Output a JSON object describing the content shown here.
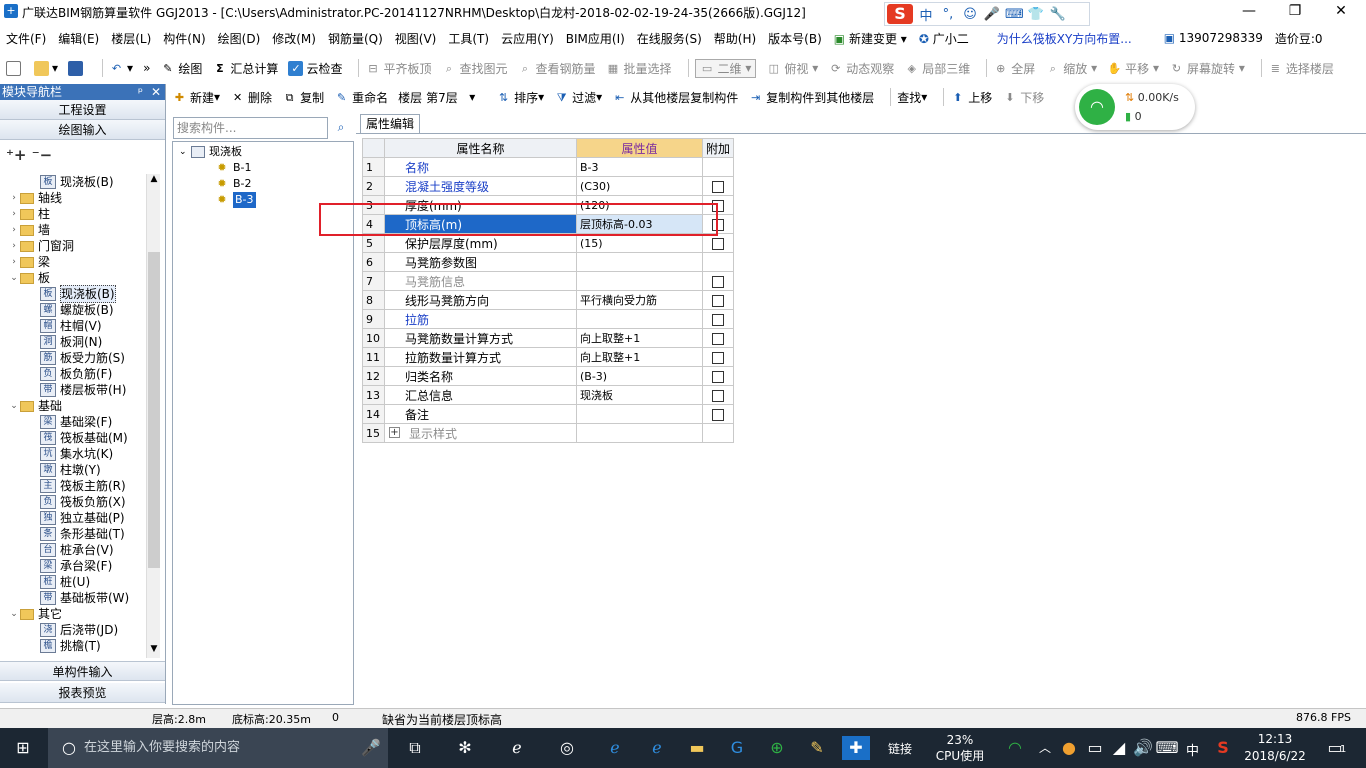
{
  "titlebar": {
    "title": "广联达BIM钢筋算量软件 GGJ2013 - [C:\\Users\\Administrator.PC-20141127NRHM\\Desktop\\白龙村-2018-02-02-19-24-35(2666版).GGJ12]",
    "minimize": "—",
    "restore": "❐",
    "close": "✕",
    "ime": {
      "logo": "S",
      "items": [
        "中",
        "°,",
        "☺",
        "🎤",
        "⌨",
        "👕",
        "🔧"
      ]
    }
  },
  "menubar": {
    "items": [
      "文件(F)",
      "编辑(E)",
      "楼层(L)",
      "构件(N)",
      "绘图(D)",
      "修改(M)",
      "钢筋量(Q)",
      "视图(V)",
      "工具(T)",
      "云应用(Y)",
      "BIM应用(I)",
      "在线服务(S)",
      "帮助(H)",
      "版本号(B)"
    ],
    "new_change": "新建变更",
    "guangxiaoer": "广小二",
    "question": "为什么筏板XY方向布置...",
    "phone": "13907298339",
    "price": "造价豆:0"
  },
  "toolbar1": {
    "draw": "绘图",
    "summary": "汇总计算",
    "cloud_check": "云检查",
    "flat_top": "平齐板顶",
    "find_elem": "查找图元",
    "view_rebar": "查看钢筋量",
    "batch_select": "批量选择",
    "view_mode": "二维",
    "overlook": "俯视",
    "dynamic_view": "动态观察",
    "local_3d": "局部三维",
    "fullscreen": "全屏",
    "zoom": "缩放",
    "pan": "平移",
    "screen_rotate": "屏幕旋转",
    "select_floor": "选择楼层"
  },
  "toolbar2": {
    "new": "新建",
    "delete": "删除",
    "copy": "复制",
    "rename": "重命名",
    "floor_label": "楼层",
    "floor_value": "第7层",
    "sort": "排序",
    "filter": "过滤",
    "copy_from": "从其他楼层复制构件",
    "copy_to": "复制构件到其他楼层",
    "find": "查找",
    "up": "上移",
    "down": "下移"
  },
  "network": {
    "speed": "0.00K/s",
    "count": "0"
  },
  "nav": {
    "header": "模块导航栏",
    "pin": "ᵖ",
    "close": "✕",
    "eng_settings": "工程设置",
    "draw_input": "绘图输入",
    "single_input": "单构件输入",
    "report_preview": "报表预览",
    "tree": [
      {
        "label": "现浇板(B)",
        "level": 2,
        "icon": "板"
      },
      {
        "label": "轴线",
        "level": 1,
        "folder": true,
        "exp": "›"
      },
      {
        "label": "柱",
        "level": 1,
        "folder": true,
        "exp": "›"
      },
      {
        "label": "墙",
        "level": 1,
        "folder": true,
        "exp": "›"
      },
      {
        "label": "门窗洞",
        "level": 1,
        "folder": true,
        "exp": "›"
      },
      {
        "label": "梁",
        "level": 1,
        "folder": true,
        "exp": "›"
      },
      {
        "label": "板",
        "level": 1,
        "folder": true,
        "exp": "⌄"
      },
      {
        "label": "现浇板(B)",
        "level": 2,
        "icon": "板",
        "sel": true
      },
      {
        "label": "螺旋板(B)",
        "level": 2,
        "icon": "螺"
      },
      {
        "label": "柱帽(V)",
        "level": 2,
        "icon": "帽"
      },
      {
        "label": "板洞(N)",
        "level": 2,
        "icon": "洞"
      },
      {
        "label": "板受力筋(S)",
        "level": 2,
        "icon": "筋"
      },
      {
        "label": "板负筋(F)",
        "level": 2,
        "icon": "负"
      },
      {
        "label": "楼层板带(H)",
        "level": 2,
        "icon": "带"
      },
      {
        "label": "基础",
        "level": 1,
        "folder": true,
        "exp": "⌄"
      },
      {
        "label": "基础梁(F)",
        "level": 2,
        "icon": "梁"
      },
      {
        "label": "筏板基础(M)",
        "level": 2,
        "icon": "筏"
      },
      {
        "label": "集水坑(K)",
        "level": 2,
        "icon": "坑"
      },
      {
        "label": "柱墩(Y)",
        "level": 2,
        "icon": "墩"
      },
      {
        "label": "筏板主筋(R)",
        "level": 2,
        "icon": "主"
      },
      {
        "label": "筏板负筋(X)",
        "level": 2,
        "icon": "负"
      },
      {
        "label": "独立基础(P)",
        "level": 2,
        "icon": "独"
      },
      {
        "label": "条形基础(T)",
        "level": 2,
        "icon": "条"
      },
      {
        "label": "桩承台(V)",
        "level": 2,
        "icon": "台"
      },
      {
        "label": "承台梁(F)",
        "level": 2,
        "icon": "梁"
      },
      {
        "label": "桩(U)",
        "level": 2,
        "icon": "桩"
      },
      {
        "label": "基础板带(W)",
        "level": 2,
        "icon": "带"
      },
      {
        "label": "其它",
        "level": 1,
        "folder": true,
        "exp": "⌄"
      },
      {
        "label": "后浇带(JD)",
        "level": 2,
        "icon": "浇"
      },
      {
        "label": "挑檐(T)",
        "level": 2,
        "icon": "檐"
      }
    ]
  },
  "search": {
    "placeholder": "搜索构件..."
  },
  "components": {
    "root": "现浇板",
    "items": [
      {
        "label": "B-1"
      },
      {
        "label": "B-2"
      },
      {
        "label": "B-3",
        "sel": true
      }
    ]
  },
  "props": {
    "tab": "属性编辑",
    "col_name": "属性名称",
    "col_value": "属性值",
    "col_add": "附加",
    "rows": [
      {
        "num": "1",
        "name": "名称",
        "value": "B-3",
        "color": "blue",
        "check": false
      },
      {
        "num": "2",
        "name": "混凝土强度等级",
        "value": "(C30)",
        "color": "blue",
        "check": true
      },
      {
        "num": "3",
        "name": "厚度(mm)",
        "value": "(120)",
        "color": "",
        "check": true
      },
      {
        "num": "4",
        "name": "顶标高(m)",
        "value": "层顶标高-0.03",
        "color": "",
        "check": true,
        "hl": true
      },
      {
        "num": "5",
        "name": "保护层厚度(mm)",
        "value": "(15)",
        "color": "",
        "check": true
      },
      {
        "num": "6",
        "name": "马凳筋参数图",
        "value": "",
        "color": "",
        "check": false
      },
      {
        "num": "7",
        "name": "马凳筋信息",
        "value": "",
        "color": "gray",
        "check": true
      },
      {
        "num": "8",
        "name": "线形马凳筋方向",
        "value": "平行横向受力筋",
        "color": "",
        "check": true
      },
      {
        "num": "9",
        "name": "拉筋",
        "value": "",
        "color": "blue",
        "check": true
      },
      {
        "num": "10",
        "name": "马凳筋数量计算方式",
        "value": "向上取整+1",
        "color": "",
        "check": true
      },
      {
        "num": "11",
        "name": "拉筋数量计算方式",
        "value": "向上取整+1",
        "color": "",
        "check": true
      },
      {
        "num": "12",
        "name": "归类名称",
        "value": "(B-3)",
        "color": "",
        "check": true
      },
      {
        "num": "13",
        "name": "汇总信息",
        "value": "现浇板",
        "color": "",
        "check": true
      },
      {
        "num": "14",
        "name": "备注",
        "value": "",
        "color": "",
        "check": true
      },
      {
        "num": "15",
        "name": "显示样式",
        "value": "",
        "color": "gray",
        "check": false,
        "plus": true
      }
    ]
  },
  "status": {
    "floor_height": "层高:2.8m",
    "base_elev": "底标高:20.35m",
    "zero": "0",
    "hint": "缺省为当前楼层顶标高",
    "fps": "876.8 FPS"
  },
  "taskbar": {
    "search_placeholder": "在这里输入你要搜索的内容",
    "link": "链接",
    "cpu_pct": "23%",
    "cpu_label": "CPU使用",
    "lang": "中",
    "time": "12:13",
    "date": "2018/6/22",
    "notif": "1"
  }
}
